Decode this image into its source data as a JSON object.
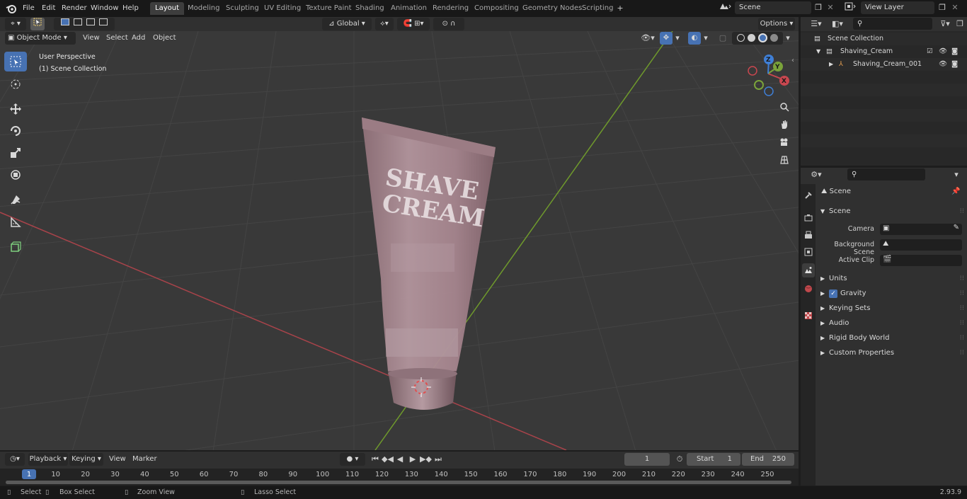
{
  "top_menu": [
    "File",
    "Edit",
    "Render",
    "Window",
    "Help"
  ],
  "workspace_tabs": [
    "Layout",
    "Modeling",
    "Sculpting",
    "UV Editing",
    "Texture Paint",
    "Shading",
    "Animation",
    "Rendering",
    "Compositing",
    "Geometry Nodes",
    "Scripting"
  ],
  "active_workspace": "Layout",
  "scene_field": "Scene",
  "view_layer_field": "View Layer",
  "viewport_header": {
    "mode": "Object Mode",
    "menus": [
      "View",
      "Select",
      "Add",
      "Object"
    ],
    "transform_orientation": "Global",
    "options_label": "Options"
  },
  "viewport_overlay": {
    "perspective_label": "User Perspective",
    "collection_label": "(1) Scene Collection"
  },
  "product_label": {
    "line1": "SHAVE",
    "line2": "CREAM"
  },
  "gizmo": {
    "x": "X",
    "y": "Y",
    "z": "Z"
  },
  "outliner": {
    "rows": [
      {
        "label": "Scene Collection",
        "indent": 0
      },
      {
        "label": "Shaving_Cream",
        "indent": 1
      },
      {
        "label": "Shaving_Cream_001",
        "indent": 2
      }
    ]
  },
  "properties": {
    "context_title": "Scene",
    "panel_title": "Scene",
    "fields": [
      {
        "label": "Camera"
      },
      {
        "label": "Background Scene"
      },
      {
        "label": "Active Clip"
      }
    ],
    "subpanels": [
      "Units",
      "Gravity",
      "Keying Sets",
      "Audio",
      "Rigid Body World",
      "Custom Properties"
    ]
  },
  "timeline": {
    "menus": [
      "Playback",
      "Keying",
      "View",
      "Marker"
    ],
    "current_frame": "1",
    "start_label": "Start",
    "start_value": "1",
    "end_label": "End",
    "end_value": "250",
    "ruler_ticks": [
      "1",
      "10",
      "20",
      "30",
      "40",
      "50",
      "60",
      "70",
      "80",
      "90",
      "100",
      "110",
      "120",
      "130",
      "140",
      "150",
      "160",
      "170",
      "180",
      "190",
      "200",
      "210",
      "220",
      "230",
      "240",
      "250"
    ]
  },
  "status_bar": {
    "items": [
      "Select",
      "Box Select",
      "Zoom View",
      "Lasso Select"
    ],
    "version": "2.93.9"
  },
  "colors": {
    "accent": "#4772b3",
    "x_axis": "#c8474f",
    "y_axis": "#7aa33a",
    "z_axis": "#3f7fd6",
    "tube": "#a88a92"
  }
}
